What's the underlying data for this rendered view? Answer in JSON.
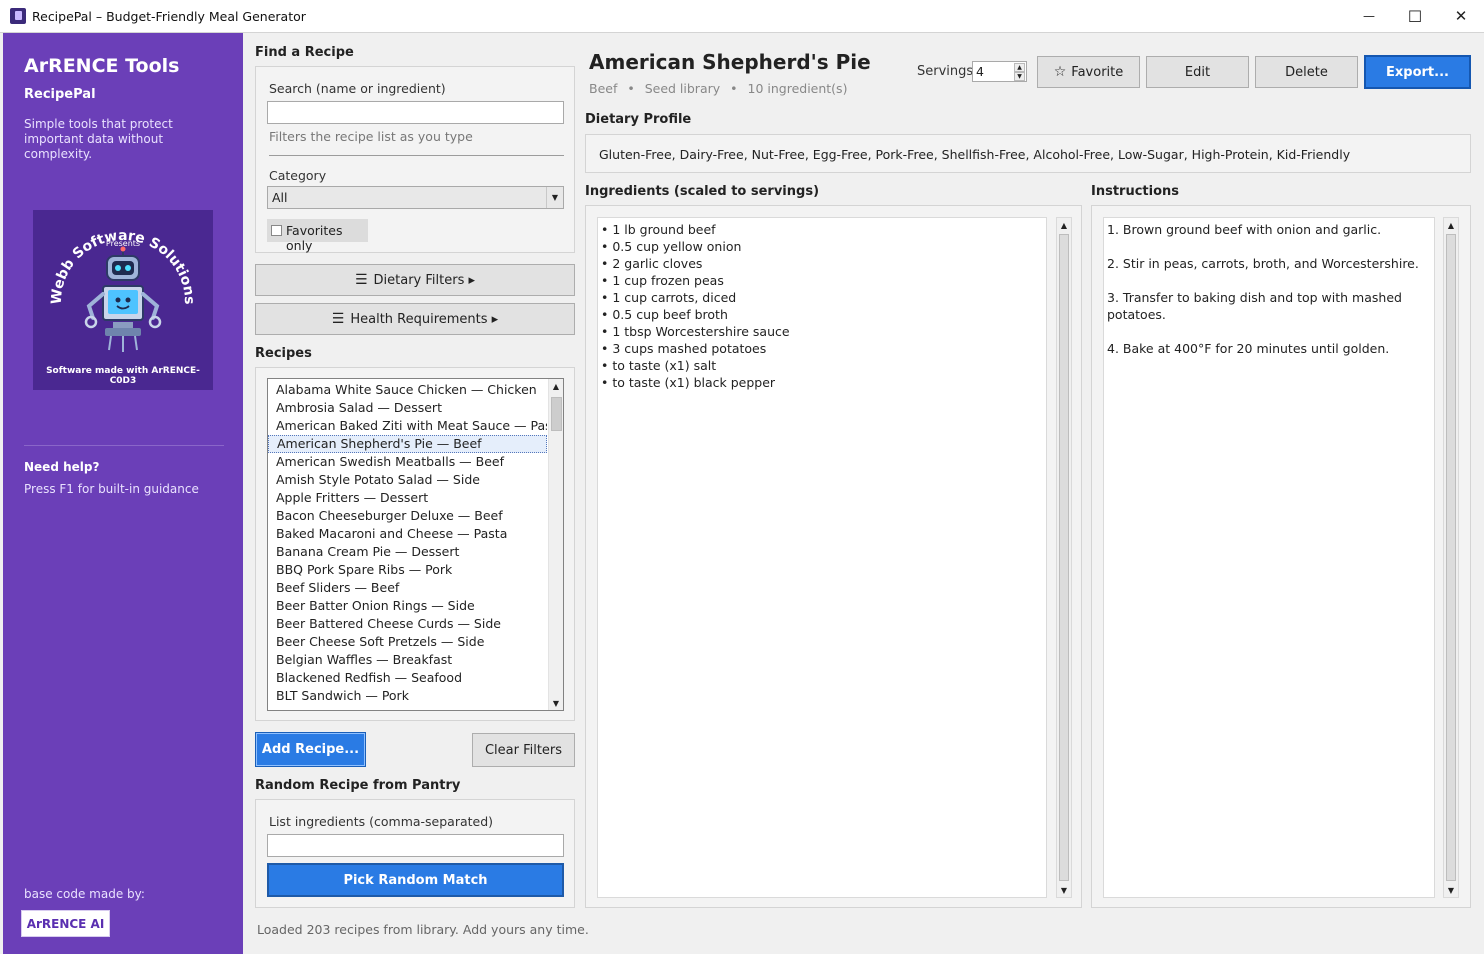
{
  "window": {
    "title": "RecipePal – Budget-Friendly Meal Generator",
    "minimize_glyph": "—",
    "maximize_glyph": "☐",
    "close_glyph": "✕"
  },
  "sidebar": {
    "brand": "ArRENCE Tools",
    "app_name": "RecipePal",
    "tagline": "Simple tools that protect important data without complexity.",
    "logo": {
      "arc_text": "Webb Software Solutions",
      "presents": "Presents",
      "footer": "Software made with ArRENCE-C0D3"
    },
    "help_title": "Need help?",
    "help_text": "Press F1 for built-in guidance",
    "base_code_label": "base code made by:",
    "base_code_button": "ArRENCE AI"
  },
  "find": {
    "title": "Find a Recipe",
    "search_label": "Search (name or ingredient)",
    "search_value": "",
    "search_hint": "Filters the recipe list as you type",
    "category_label": "Category",
    "category_value": "All",
    "favorites_label": "Favorites only",
    "dietary_button": "Dietary Filters ▸",
    "health_button": "Health Requirements ▸"
  },
  "recipes": {
    "title": "Recipes",
    "items": [
      "Alabama White Sauce Chicken  — Chicken",
      "Ambrosia Salad  — Dessert",
      "American Baked Ziti with Meat Sauce  — Pasta",
      "American Shepherd's Pie  — Beef",
      "American Swedish Meatballs  — Beef",
      "Amish Style Potato Salad  — Side",
      "Apple Fritters  — Dessert",
      "Bacon Cheeseburger Deluxe  — Beef",
      "Baked Macaroni and Cheese  — Pasta",
      "Banana Cream Pie  — Dessert",
      "BBQ Pork Spare Ribs  — Pork",
      "Beef Sliders  — Beef",
      "Beer Batter Onion Rings  — Side",
      "Beer Battered Cheese Curds  — Side",
      "Beer Cheese Soft Pretzels  — Side",
      "Belgian Waffles  — Breakfast",
      "Blackened Redfish  — Seafood",
      "BLT Sandwich  — Pork"
    ],
    "selected_index": 3,
    "add_button": "Add Recipe...",
    "clear_button": "Clear Filters"
  },
  "random": {
    "title": "Random Recipe from Pantry",
    "label": "List ingredients (comma-separated)",
    "value": "",
    "button": "Pick Random Match"
  },
  "status": "Loaded 203 recipes from library. Add yours any time.",
  "detail": {
    "title": "American Shepherd's Pie",
    "meta_category": "Beef",
    "meta_source": "Seed library",
    "meta_count": "10 ingredient(s)",
    "meta_sep": "•",
    "servings_label": "Servings",
    "servings_value": "4",
    "favorite_button": "Favorite",
    "edit_button": "Edit",
    "delete_button": "Delete",
    "export_button": "Export...",
    "dietary_title": "Dietary Profile",
    "dietary_text": "Gluten-Free, Dairy-Free, Nut-Free, Egg-Free, Pork-Free, Shellfish-Free, Alcohol-Free, Low-Sugar, High-Protein, Kid-Friendly",
    "ingredients_title": "Ingredients (scaled to servings)",
    "ingredients": [
      "• 1 lb ground beef",
      "• 0.5 cup yellow onion",
      "• 2 garlic cloves",
      "• 1 cup frozen peas",
      "• 1 cup carrots, diced",
      "• 0.5 cup beef broth",
      "• 1 tbsp Worcestershire sauce",
      "• 3 cups mashed potatoes",
      "• to taste (x1) salt",
      "• to taste (x1) black pepper"
    ],
    "instructions_title": "Instructions",
    "instructions": [
      "1. Brown ground beef with onion and garlic.",
      "2. Stir in peas, carrots, broth, and Worcestershire.",
      "3. Transfer to baking dish and top with mashed",
      "potatoes.",
      "4. Bake at 400°F for 20 minutes until golden."
    ]
  },
  "icons": {
    "hamburger": "☰",
    "star": "☆",
    "dropdown": "▼",
    "up": "▲",
    "down": "▼"
  },
  "colors": {
    "sidebar": "#6b3fb8",
    "accent": "#2a7be4"
  }
}
